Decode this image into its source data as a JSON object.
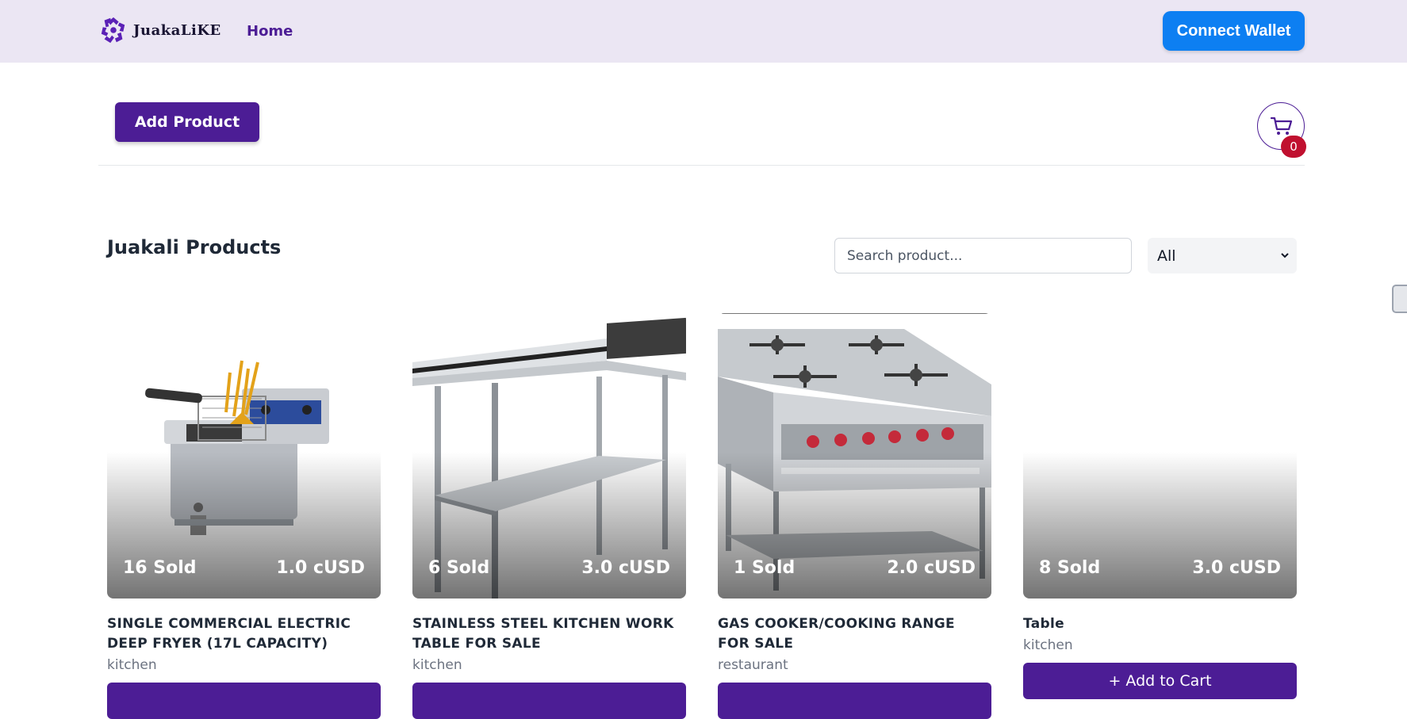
{
  "navbar": {
    "brand": "JuakaLiKE",
    "home_link": "Home",
    "connect_wallet": "Connect Wallet"
  },
  "toolbar": {
    "add_product": "Add Product",
    "cart_count": "0"
  },
  "products_section": {
    "title": "Juakali Products",
    "search_placeholder": "Search product...",
    "category_filter": {
      "selected": "All",
      "options": [
        "All"
      ]
    }
  },
  "products": [
    {
      "sold": "16 Sold",
      "price": "1.0 cUSD",
      "name": "SINGLE COMMERCIAL ELECTRIC DEEP FRYER (17L CAPACITY)",
      "category": "kitchen",
      "image": "deep-fryer-image"
    },
    {
      "sold": "6 Sold",
      "price": "3.0 cUSD",
      "name": "STAINLESS STEEL KITCHEN WORK TABLE FOR SALE",
      "category": "kitchen",
      "image": "steel-table-image"
    },
    {
      "sold": "1 Sold",
      "price": "2.0 cUSD",
      "name": "GAS COOKER/COOKING RANGE FOR SALE",
      "category": "restaurant",
      "image": "gas-cooker-image"
    },
    {
      "sold": "8 Sold",
      "price": "3.0 cUSD",
      "name": "Table",
      "category": "kitchen",
      "image": "blank-image",
      "add_to_cart": "+ Add to Cart"
    }
  ],
  "colors": {
    "navbar_bg": "#ebe6f3",
    "brand_purple": "#4c1d95",
    "wallet_blue": "#0d7ff2",
    "badge_red": "#c0102f"
  }
}
